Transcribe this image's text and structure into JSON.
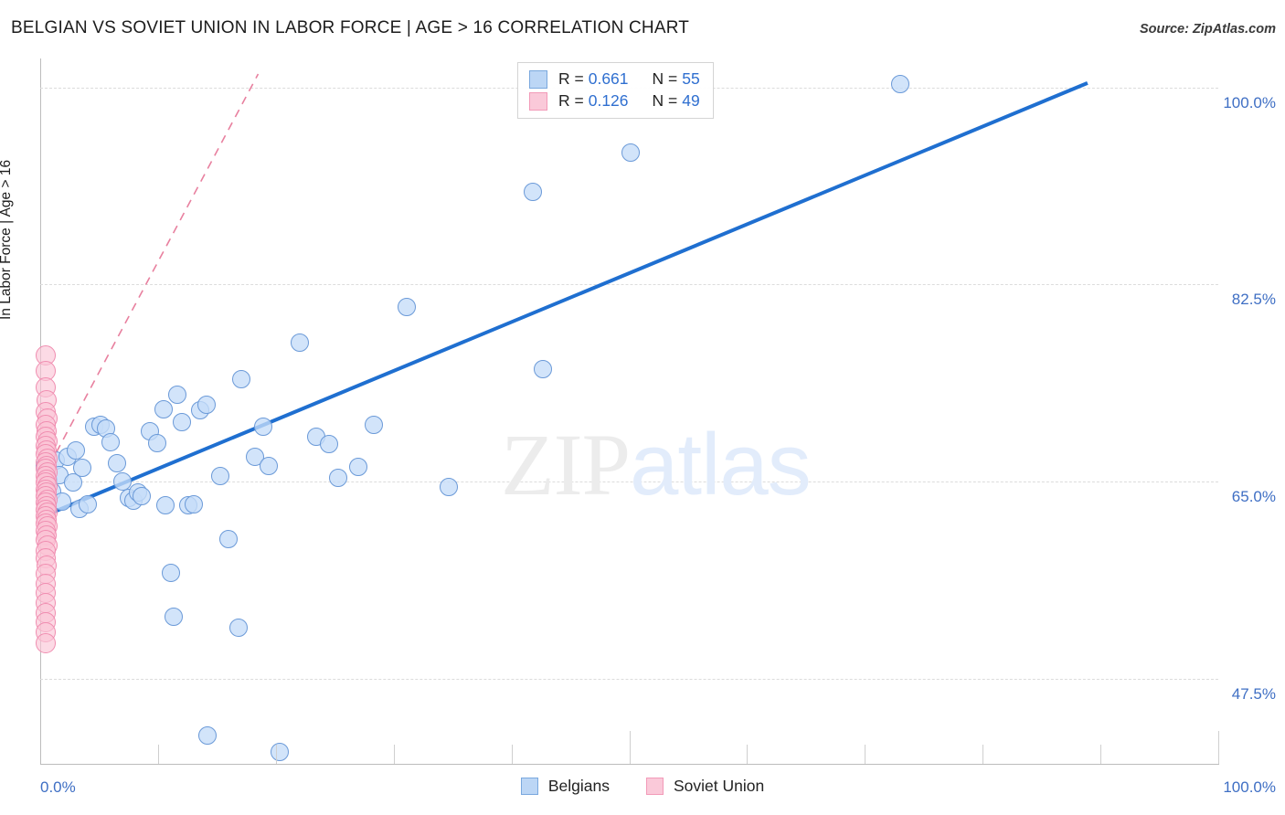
{
  "header": {
    "title": "BELGIAN VS SOVIET UNION IN LABOR FORCE | AGE > 16 CORRELATION CHART",
    "source": "Source: ZipAtlas.com"
  },
  "watermark": {
    "part1": "ZIP",
    "part2": "atlas"
  },
  "stats_legend": {
    "rows": [
      {
        "series": "Belgians",
        "r_label": "R =",
        "r_value": "0.661",
        "n_label": "N =",
        "n_value": "55",
        "color": "#bcd6f5"
      },
      {
        "series": "Soviet Union",
        "r_label": "R =",
        "r_value": "0.126",
        "n_label": "N =",
        "n_value": "49",
        "color": "#fac9d9"
      }
    ]
  },
  "bottom_legend": {
    "items": [
      {
        "label": "Belgians",
        "color": "#bcd6f5"
      },
      {
        "label": "Soviet Union",
        "color": "#fac9d9"
      }
    ]
  },
  "axes": {
    "y_title": "In Labor Force | Age > 16",
    "y_ticks": [
      "100.0%",
      "82.5%",
      "65.0%",
      "47.5%"
    ],
    "x_min_label": "0.0%",
    "x_max_label": "100.0%"
  },
  "chart_data": {
    "type": "scatter",
    "title": "BELGIAN VS SOVIET UNION IN LABOR FORCE | AGE > 16 CORRELATION CHART",
    "xlabel": "",
    "ylabel": "In Labor Force | Age > 16",
    "xlim": [
      0,
      100
    ],
    "ylim": [
      40.0,
      102.5
    ],
    "x_tick_labels": [
      "0.0%",
      "100.0%"
    ],
    "y_tick_values": [
      100.0,
      82.5,
      65.0,
      47.5
    ],
    "grid": true,
    "legend_position": "bottom-center",
    "series": [
      {
        "name": "Belgians",
        "color": "#c5dcf8",
        "edge_color": "#6b9ad8",
        "R": 0.661,
        "N": 55,
        "trendline": {
          "style": "solid",
          "color": "#1f6fd0",
          "x0": 0.0,
          "y0": 61.8,
          "x1": 88.9,
          "y1": 100.4
        },
        "points": [
          [
            0.4,
            66.4
          ],
          [
            0.7,
            65.1
          ],
          [
            1.0,
            64.1
          ],
          [
            1.3,
            66.9
          ],
          [
            1.6,
            65.6
          ],
          [
            1.9,
            63.2
          ],
          [
            2.3,
            67.2
          ],
          [
            2.8,
            64.9
          ],
          [
            3.3,
            62.6
          ],
          [
            3.6,
            66.2
          ],
          [
            4.0,
            63.0
          ],
          [
            4.6,
            69.9
          ],
          [
            5.1,
            70.0
          ],
          [
            5.6,
            69.7
          ],
          [
            6.0,
            68.5
          ],
          [
            6.5,
            66.6
          ],
          [
            7.0,
            65.0
          ],
          [
            7.5,
            63.5
          ],
          [
            7.9,
            63.3
          ],
          [
            8.3,
            64.0
          ],
          [
            8.6,
            63.7
          ],
          [
            9.3,
            69.5
          ],
          [
            9.9,
            68.4
          ],
          [
            10.5,
            71.4
          ],
          [
            10.6,
            62.9
          ],
          [
            11.1,
            56.9
          ],
          [
            11.3,
            53.0
          ],
          [
            11.6,
            72.7
          ],
          [
            12.0,
            70.3
          ],
          [
            12.6,
            62.9
          ],
          [
            13.0,
            63.0
          ],
          [
            13.6,
            71.3
          ],
          [
            14.1,
            71.8
          ],
          [
            14.2,
            42.4
          ],
          [
            15.3,
            65.5
          ],
          [
            16.0,
            59.9
          ],
          [
            16.8,
            52.0
          ],
          [
            17.1,
            74.1
          ],
          [
            18.2,
            67.2
          ],
          [
            18.9,
            69.9
          ],
          [
            19.4,
            66.4
          ],
          [
            20.3,
            41.0
          ],
          [
            22.0,
            77.3
          ],
          [
            23.4,
            69.0
          ],
          [
            24.5,
            68.3
          ],
          [
            25.3,
            65.3
          ],
          [
            27.0,
            66.3
          ],
          [
            28.3,
            70.0
          ],
          [
            31.1,
            80.5
          ],
          [
            34.7,
            64.5
          ],
          [
            41.8,
            90.7
          ],
          [
            42.7,
            75.0
          ],
          [
            50.1,
            94.2
          ],
          [
            73.0,
            100.3
          ],
          [
            3.0,
            67.8
          ]
        ]
      },
      {
        "name": "Soviet Union",
        "color": "#fac9d9",
        "edge_color": "#f08db0",
        "R": 0.126,
        "N": 49,
        "trendline": {
          "style": "dashed",
          "color": "#e8809f",
          "x0": 0.2,
          "y0": 65.3,
          "x1": 18.5,
          "y1": 101.2
        },
        "points": [
          [
            0.45,
            76.2
          ],
          [
            0.45,
            74.8
          ],
          [
            0.5,
            73.4
          ],
          [
            0.55,
            72.2
          ],
          [
            0.5,
            71.2
          ],
          [
            0.6,
            70.6
          ],
          [
            0.45,
            70.0
          ],
          [
            0.55,
            69.5
          ],
          [
            0.5,
            69.0
          ],
          [
            0.6,
            68.6
          ],
          [
            0.45,
            68.2
          ],
          [
            0.55,
            67.8
          ],
          [
            0.5,
            67.4
          ],
          [
            0.6,
            67.0
          ],
          [
            0.45,
            66.7
          ],
          [
            0.55,
            66.4
          ],
          [
            0.5,
            66.1
          ],
          [
            0.6,
            65.8
          ],
          [
            0.45,
            65.5
          ],
          [
            0.55,
            65.2
          ],
          [
            0.5,
            64.9
          ],
          [
            0.6,
            64.6
          ],
          [
            0.45,
            64.3
          ],
          [
            0.55,
            64.0
          ],
          [
            0.5,
            63.7
          ],
          [
            0.6,
            63.4
          ],
          [
            0.45,
            63.1
          ],
          [
            0.55,
            62.8
          ],
          [
            0.5,
            62.5
          ],
          [
            0.6,
            62.2
          ],
          [
            0.45,
            61.9
          ],
          [
            0.55,
            61.6
          ],
          [
            0.5,
            61.3
          ],
          [
            0.6,
            61.0
          ],
          [
            0.45,
            60.6
          ],
          [
            0.55,
            60.2
          ],
          [
            0.5,
            59.8
          ],
          [
            0.6,
            59.3
          ],
          [
            0.45,
            58.8
          ],
          [
            0.5,
            58.2
          ],
          [
            0.55,
            57.5
          ],
          [
            0.5,
            56.8
          ],
          [
            0.45,
            55.9
          ],
          [
            0.5,
            55.1
          ],
          [
            0.45,
            54.2
          ],
          [
            0.5,
            53.3
          ],
          [
            0.45,
            52.5
          ],
          [
            0.5,
            51.6
          ],
          [
            0.45,
            50.6
          ]
        ]
      }
    ]
  }
}
